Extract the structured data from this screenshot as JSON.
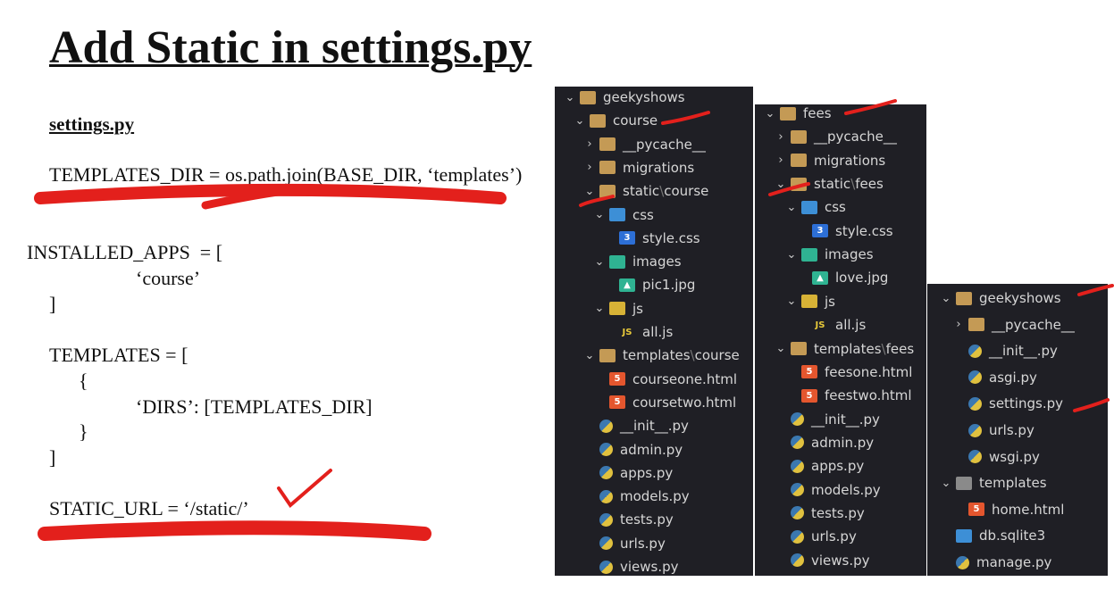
{
  "slide": {
    "title": "Add Static in settings.py",
    "subtitle": "settings.py",
    "lines": [
      "TEMPLATES_DIR = os.path.join(BASE_DIR, ‘templates’)",
      "INSTALLED_APPS  = [",
      "‘course’",
      "]",
      "TEMPLATES = [",
      "{",
      "‘DIRS’: [TEMPLATES_DIR]",
      "}",
      "]",
      "STATIC_URL = ‘/static/’"
    ]
  },
  "colors": {
    "panel_bg": "#1f1f25",
    "annotation": "#e3201c"
  },
  "panels": [
    {
      "rows": [
        {
          "label": "geekyshows",
          "indent": 0,
          "chev": "v",
          "icon": "folder"
        },
        {
          "label": "course",
          "indent": 1,
          "chev": "v",
          "icon": "folder"
        },
        {
          "label": "__pycache__",
          "indent": 2,
          "chev": ">",
          "icon": "folder"
        },
        {
          "label": "migrations",
          "indent": 2,
          "chev": ">",
          "icon": "folder"
        },
        {
          "label": "static",
          "sub": "course",
          "indent": 2,
          "chev": "v",
          "icon": "folder"
        },
        {
          "label": "css",
          "indent": 3,
          "chev": "v",
          "icon": "folder-css"
        },
        {
          "label": "style.css",
          "indent": 4,
          "chev": "",
          "icon": "css"
        },
        {
          "label": "images",
          "indent": 3,
          "chev": "v",
          "icon": "folder-images"
        },
        {
          "label": "pic1.jpg",
          "indent": 4,
          "chev": "",
          "icon": "image"
        },
        {
          "label": "js",
          "indent": 3,
          "chev": "v",
          "icon": "folder-js"
        },
        {
          "label": "all.js",
          "indent": 4,
          "chev": "",
          "icon": "js"
        },
        {
          "label": "templates",
          "sub": "course",
          "indent": 2,
          "chev": "v",
          "icon": "folder"
        },
        {
          "label": "courseone.html",
          "indent": 3,
          "chev": "",
          "icon": "html"
        },
        {
          "label": "coursetwo.html",
          "indent": 3,
          "chev": "",
          "icon": "html"
        },
        {
          "label": "__init__.py",
          "indent": 2,
          "chev": "",
          "icon": "python"
        },
        {
          "label": "admin.py",
          "indent": 2,
          "chev": "",
          "icon": "python"
        },
        {
          "label": "apps.py",
          "indent": 2,
          "chev": "",
          "icon": "python"
        },
        {
          "label": "models.py",
          "indent": 2,
          "chev": "",
          "icon": "python"
        },
        {
          "label": "tests.py",
          "indent": 2,
          "chev": "",
          "icon": "python"
        },
        {
          "label": "urls.py",
          "indent": 2,
          "chev": "",
          "icon": "python"
        },
        {
          "label": "views.py",
          "indent": 2,
          "chev": "",
          "icon": "python"
        }
      ]
    },
    {
      "rows": [
        {
          "label": "fees",
          "indent": 0,
          "chev": "v",
          "icon": "folder"
        },
        {
          "label": "__pycache__",
          "indent": 1,
          "chev": ">",
          "icon": "folder"
        },
        {
          "label": "migrations",
          "indent": 1,
          "chev": ">",
          "icon": "folder"
        },
        {
          "label": "static",
          "sub": "fees",
          "indent": 1,
          "chev": "v",
          "icon": "folder"
        },
        {
          "label": "css",
          "indent": 2,
          "chev": "v",
          "icon": "folder-css"
        },
        {
          "label": "style.css",
          "indent": 3,
          "chev": "",
          "icon": "css"
        },
        {
          "label": "images",
          "indent": 2,
          "chev": "v",
          "icon": "folder-images"
        },
        {
          "label": "love.jpg",
          "indent": 3,
          "chev": "",
          "icon": "image"
        },
        {
          "label": "js",
          "indent": 2,
          "chev": "v",
          "icon": "folder-js"
        },
        {
          "label": "all.js",
          "indent": 3,
          "chev": "",
          "icon": "js"
        },
        {
          "label": "templates",
          "sub": "fees",
          "indent": 1,
          "chev": "v",
          "icon": "folder"
        },
        {
          "label": "feesone.html",
          "indent": 2,
          "chev": "",
          "icon": "html"
        },
        {
          "label": "feestwo.html",
          "indent": 2,
          "chev": "",
          "icon": "html"
        },
        {
          "label": "__init__.py",
          "indent": 1,
          "chev": "",
          "icon": "python"
        },
        {
          "label": "admin.py",
          "indent": 1,
          "chev": "",
          "icon": "python"
        },
        {
          "label": "apps.py",
          "indent": 1,
          "chev": "",
          "icon": "python"
        },
        {
          "label": "models.py",
          "indent": 1,
          "chev": "",
          "icon": "python"
        },
        {
          "label": "tests.py",
          "indent": 1,
          "chev": "",
          "icon": "python"
        },
        {
          "label": "urls.py",
          "indent": 1,
          "chev": "",
          "icon": "python"
        },
        {
          "label": "views.py",
          "indent": 1,
          "chev": "",
          "icon": "python"
        }
      ]
    },
    {
      "rows": [
        {
          "label": "geekyshows",
          "indent": 0,
          "chev": "v",
          "icon": "folder"
        },
        {
          "label": "__pycache__",
          "indent": 1,
          "chev": ">",
          "icon": "folder"
        },
        {
          "label": "__init__.py",
          "indent": 1,
          "chev": "",
          "icon": "python"
        },
        {
          "label": "asgi.py",
          "indent": 1,
          "chev": "",
          "icon": "python"
        },
        {
          "label": "settings.py",
          "indent": 1,
          "chev": "",
          "icon": "python"
        },
        {
          "label": "urls.py",
          "indent": 1,
          "chev": "",
          "icon": "python"
        },
        {
          "label": "wsgi.py",
          "indent": 1,
          "chev": "",
          "icon": "python"
        },
        {
          "label": "templates",
          "indent": 0,
          "chev": "v",
          "icon": "folder-templates"
        },
        {
          "label": "home.html",
          "indent": 1,
          "chev": "",
          "icon": "html"
        },
        {
          "label": "db.sqlite3",
          "indent": 0,
          "chev": "",
          "icon": "database"
        },
        {
          "label": "manage.py",
          "indent": 0,
          "chev": "",
          "icon": "python"
        }
      ]
    }
  ]
}
